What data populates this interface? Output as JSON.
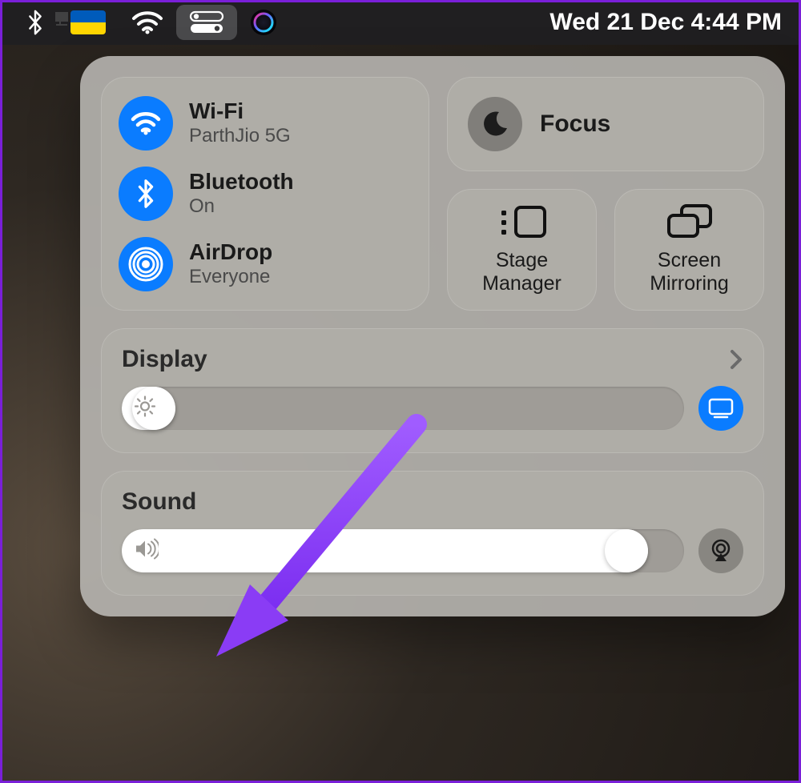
{
  "menubar": {
    "datetime": "Wed 21 Dec  4:44 PM"
  },
  "controlCenter": {
    "wifi": {
      "title": "Wi-Fi",
      "sub": "ParthJio 5G"
    },
    "bluetooth": {
      "title": "Bluetooth",
      "sub": "On"
    },
    "airdrop": {
      "title": "AirDrop",
      "sub": "Everyone"
    },
    "focus": {
      "title": "Focus"
    },
    "stageManager": {
      "label": "Stage\nManager"
    },
    "screenMirroring": {
      "label": "Screen\nMirroring"
    },
    "display": {
      "title": "Display",
      "brightnessPercent": 2
    },
    "sound": {
      "title": "Sound",
      "volumePercent": 93
    }
  },
  "colors": {
    "accent": "#0a7cff",
    "annotation": "#8a3cf5"
  }
}
